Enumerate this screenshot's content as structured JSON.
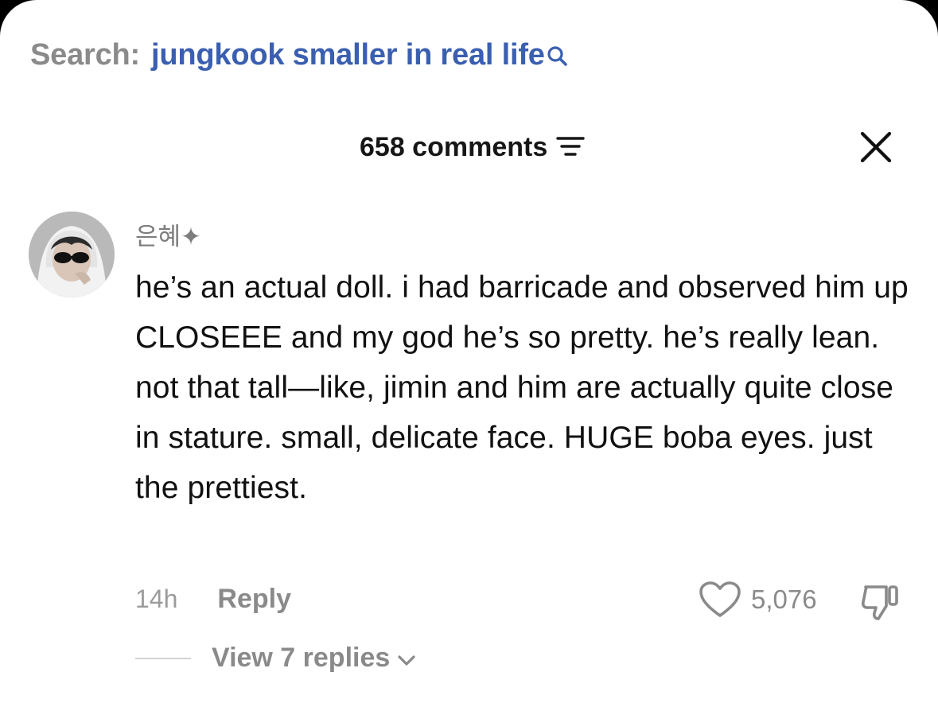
{
  "search": {
    "label": "Search:",
    "query": "jungkook smaller in real life"
  },
  "header": {
    "comment_count": "658 comments",
    "filter_icon": "filter-lines-icon",
    "close_icon": "close-icon"
  },
  "comment": {
    "username": "은혜✦",
    "text": "he’s an actual doll. i had barricade and observed him up CLOSEEE and my god he’s so pretty. he’s really lean. not that tall—like, jimin and him are actually quite close in stature. small, delicate face. HUGE boba eyes. just the prettiest.",
    "time": "14h",
    "reply_label": "Reply",
    "like_count": "5,076",
    "view_replies": "View 7 replies"
  },
  "colors": {
    "search_query": "#3b5fb0",
    "muted": "#8a8a8a",
    "text": "#111111"
  }
}
